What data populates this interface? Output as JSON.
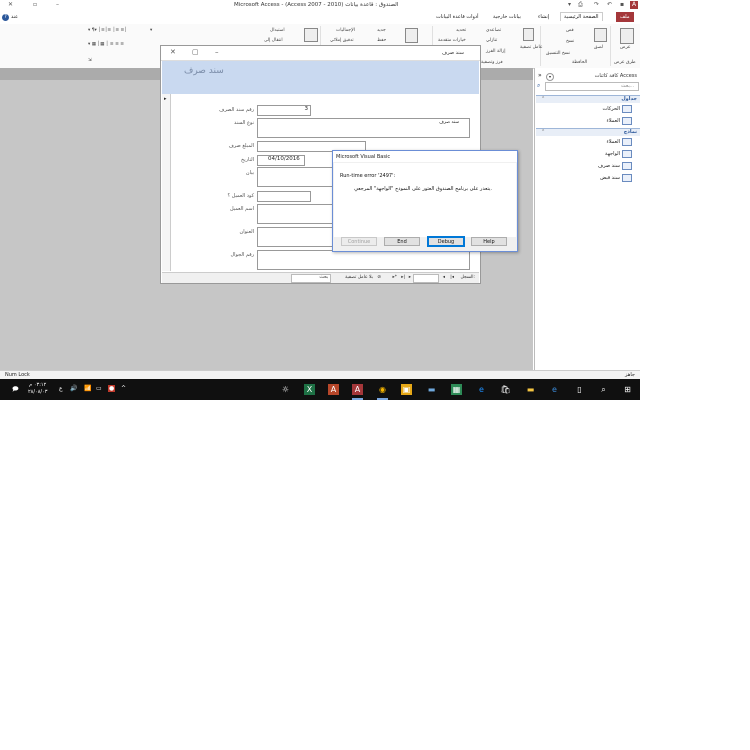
{
  "window": {
    "title": "Microsoft Access - (Access 2007 - 2010) الصندوق : قاعدة بيانات",
    "minimize": "–",
    "restore": "▫",
    "close": "✕"
  },
  "ribbon": {
    "tabs": [
      "ملف",
      "الصفحة الرئيسية",
      "إنشاء",
      "بيانات خارجية",
      "أدوات قاعدة البيانات"
    ],
    "tell_me": "عند",
    "groups": {
      "views": "طرق عرض",
      "view_btn": "عرض",
      "clipboard": "الحافظة",
      "paste": "لصق",
      "cut": "قص",
      "copy": "نسخ",
      "format_painter": "نسخ التنسيق",
      "sort_filter": "فرز وتصفية",
      "filter": "عامل تصفية",
      "ascending": "تصاعدي",
      "descending": "تنازلي",
      "remove_sort": "إزالة الفرز",
      "selection": "تحديد",
      "advanced": "خيارات متقدمة",
      "toggle_filter": "تبديل عامل التصفية",
      "records": "السجلات",
      "new": "جديد",
      "save": "حفظ",
      "delete": "حذف",
      "totals": "الإجماليات",
      "spelling": "تدقيق إملائي",
      "more": "المزيد",
      "find": "بحث",
      "replace": "استبدال",
      "goto": "انتقال إلى"
    }
  },
  "nav": {
    "title": "كافة كائنات Access",
    "search_placeholder": "بحث...",
    "groups": [
      {
        "label": "جداول",
        "items": [
          "الحركات",
          "العملاء"
        ]
      },
      {
        "label": "نماذج",
        "items": [
          "العملاء",
          "الواجهة",
          "سند صرف",
          "سند قبض"
        ]
      }
    ]
  },
  "form": {
    "window_title": "سند صرف",
    "header": "سند صرف",
    "fields": {
      "voucher_no_label": "رقم سند الصرف",
      "voucher_no": "3",
      "type_label": "نوع السند",
      "type_value": "سند صرف",
      "amount_label": "المبلغ صرف",
      "date_label": "التاريخ",
      "date_value": "04/10/2016",
      "statement_label": "بيان",
      "client_code_label": "كود العميل ؟",
      "client_name_label": "اسم العميل",
      "address_label": "العنوان",
      "mobile_label": "رقم الجوال"
    },
    "record_nav": {
      "record_label": "السجل:",
      "no_filter": "بلا عامل تصفية",
      "search": "بحث"
    }
  },
  "dialog": {
    "title": "Microsoft Visual Basic",
    "error": "Run-time error '2497':",
    "message": "يتعذر على برنامج الصندوق العثور على النموذج \"الواجهة\" المرجعي.",
    "buttons": {
      "continue": "Continue",
      "end": "End",
      "debug": "Debug",
      "help": "Help"
    }
  },
  "status": {
    "left": "Num Lock",
    "right": "جاهز"
  },
  "taskbar": {
    "time": "٠٣:١٢ م",
    "date": "٢٨/٠٨/٠٣",
    "lang": "ع"
  }
}
